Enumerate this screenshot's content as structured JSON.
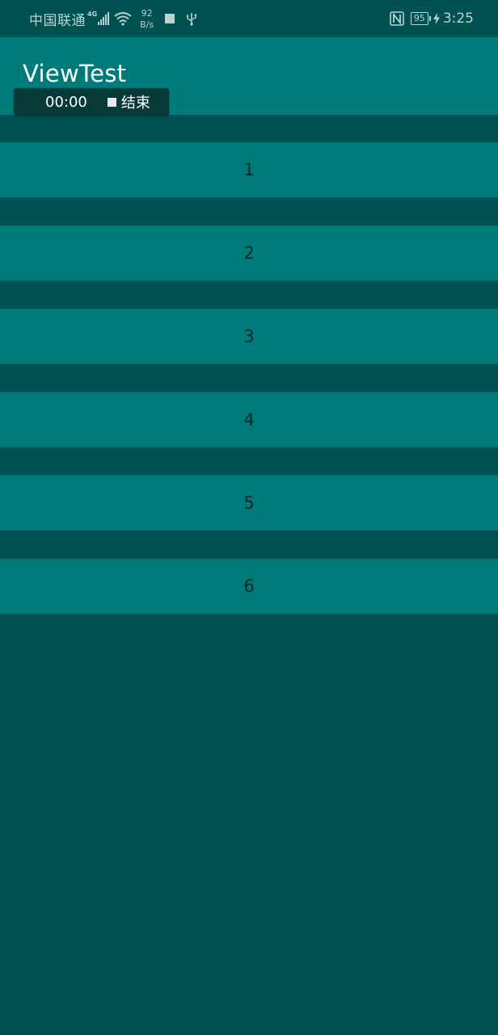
{
  "status_bar": {
    "carrier": "中国联通",
    "network_type": "4G",
    "net_speed_value": "92",
    "net_speed_unit": "B/s",
    "battery_level": "95",
    "time": "3:25"
  },
  "app_bar": {
    "title": "ViewTest"
  },
  "recorder": {
    "time": "00:00",
    "end_label": "结束"
  },
  "list": {
    "items": [
      {
        "label": "1"
      },
      {
        "label": "2"
      },
      {
        "label": "3"
      },
      {
        "label": "4"
      },
      {
        "label": "5"
      },
      {
        "label": "6"
      }
    ]
  },
  "colors": {
    "background": "#005252",
    "primary": "#007b7b",
    "status_text": "#b9d3d1",
    "item_text": "#0d2626"
  },
  "icons": [
    "signal-icon",
    "wifi-icon",
    "square-icon",
    "usb-icon",
    "nfc-icon",
    "battery-icon",
    "charging-bolt-icon",
    "stop-icon"
  ]
}
